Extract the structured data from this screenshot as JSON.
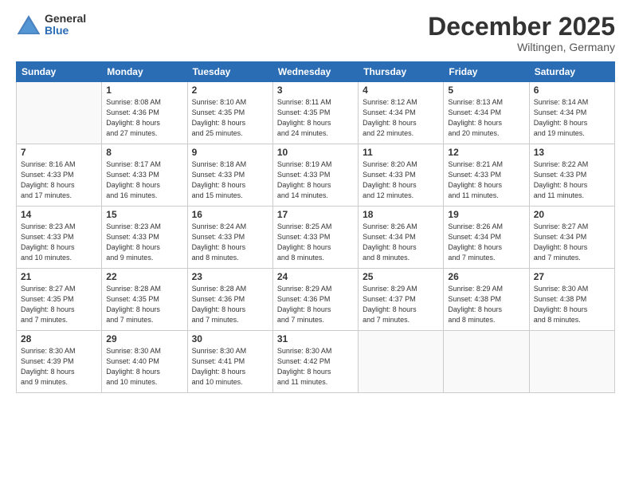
{
  "header": {
    "logo_general": "General",
    "logo_blue": "Blue",
    "month_title": "December 2025",
    "location": "Wiltingen, Germany"
  },
  "days_of_week": [
    "Sunday",
    "Monday",
    "Tuesday",
    "Wednesday",
    "Thursday",
    "Friday",
    "Saturday"
  ],
  "weeks": [
    [
      {
        "day": "",
        "info": ""
      },
      {
        "day": "1",
        "info": "Sunrise: 8:08 AM\nSunset: 4:36 PM\nDaylight: 8 hours\nand 27 minutes."
      },
      {
        "day": "2",
        "info": "Sunrise: 8:10 AM\nSunset: 4:35 PM\nDaylight: 8 hours\nand 25 minutes."
      },
      {
        "day": "3",
        "info": "Sunrise: 8:11 AM\nSunset: 4:35 PM\nDaylight: 8 hours\nand 24 minutes."
      },
      {
        "day": "4",
        "info": "Sunrise: 8:12 AM\nSunset: 4:34 PM\nDaylight: 8 hours\nand 22 minutes."
      },
      {
        "day": "5",
        "info": "Sunrise: 8:13 AM\nSunset: 4:34 PM\nDaylight: 8 hours\nand 20 minutes."
      },
      {
        "day": "6",
        "info": "Sunrise: 8:14 AM\nSunset: 4:34 PM\nDaylight: 8 hours\nand 19 minutes."
      }
    ],
    [
      {
        "day": "7",
        "info": "Sunrise: 8:16 AM\nSunset: 4:33 PM\nDaylight: 8 hours\nand 17 minutes."
      },
      {
        "day": "8",
        "info": "Sunrise: 8:17 AM\nSunset: 4:33 PM\nDaylight: 8 hours\nand 16 minutes."
      },
      {
        "day": "9",
        "info": "Sunrise: 8:18 AM\nSunset: 4:33 PM\nDaylight: 8 hours\nand 15 minutes."
      },
      {
        "day": "10",
        "info": "Sunrise: 8:19 AM\nSunset: 4:33 PM\nDaylight: 8 hours\nand 14 minutes."
      },
      {
        "day": "11",
        "info": "Sunrise: 8:20 AM\nSunset: 4:33 PM\nDaylight: 8 hours\nand 12 minutes."
      },
      {
        "day": "12",
        "info": "Sunrise: 8:21 AM\nSunset: 4:33 PM\nDaylight: 8 hours\nand 11 minutes."
      },
      {
        "day": "13",
        "info": "Sunrise: 8:22 AM\nSunset: 4:33 PM\nDaylight: 8 hours\nand 11 minutes."
      }
    ],
    [
      {
        "day": "14",
        "info": "Sunrise: 8:23 AM\nSunset: 4:33 PM\nDaylight: 8 hours\nand 10 minutes."
      },
      {
        "day": "15",
        "info": "Sunrise: 8:23 AM\nSunset: 4:33 PM\nDaylight: 8 hours\nand 9 minutes."
      },
      {
        "day": "16",
        "info": "Sunrise: 8:24 AM\nSunset: 4:33 PM\nDaylight: 8 hours\nand 8 minutes."
      },
      {
        "day": "17",
        "info": "Sunrise: 8:25 AM\nSunset: 4:33 PM\nDaylight: 8 hours\nand 8 minutes."
      },
      {
        "day": "18",
        "info": "Sunrise: 8:26 AM\nSunset: 4:34 PM\nDaylight: 8 hours\nand 8 minutes."
      },
      {
        "day": "19",
        "info": "Sunrise: 8:26 AM\nSunset: 4:34 PM\nDaylight: 8 hours\nand 7 minutes."
      },
      {
        "day": "20",
        "info": "Sunrise: 8:27 AM\nSunset: 4:34 PM\nDaylight: 8 hours\nand 7 minutes."
      }
    ],
    [
      {
        "day": "21",
        "info": "Sunrise: 8:27 AM\nSunset: 4:35 PM\nDaylight: 8 hours\nand 7 minutes."
      },
      {
        "day": "22",
        "info": "Sunrise: 8:28 AM\nSunset: 4:35 PM\nDaylight: 8 hours\nand 7 minutes."
      },
      {
        "day": "23",
        "info": "Sunrise: 8:28 AM\nSunset: 4:36 PM\nDaylight: 8 hours\nand 7 minutes."
      },
      {
        "day": "24",
        "info": "Sunrise: 8:29 AM\nSunset: 4:36 PM\nDaylight: 8 hours\nand 7 minutes."
      },
      {
        "day": "25",
        "info": "Sunrise: 8:29 AM\nSunset: 4:37 PM\nDaylight: 8 hours\nand 7 minutes."
      },
      {
        "day": "26",
        "info": "Sunrise: 8:29 AM\nSunset: 4:38 PM\nDaylight: 8 hours\nand 8 minutes."
      },
      {
        "day": "27",
        "info": "Sunrise: 8:30 AM\nSunset: 4:38 PM\nDaylight: 8 hours\nand 8 minutes."
      }
    ],
    [
      {
        "day": "28",
        "info": "Sunrise: 8:30 AM\nSunset: 4:39 PM\nDaylight: 8 hours\nand 9 minutes."
      },
      {
        "day": "29",
        "info": "Sunrise: 8:30 AM\nSunset: 4:40 PM\nDaylight: 8 hours\nand 10 minutes."
      },
      {
        "day": "30",
        "info": "Sunrise: 8:30 AM\nSunset: 4:41 PM\nDaylight: 8 hours\nand 10 minutes."
      },
      {
        "day": "31",
        "info": "Sunrise: 8:30 AM\nSunset: 4:42 PM\nDaylight: 8 hours\nand 11 minutes."
      },
      {
        "day": "",
        "info": ""
      },
      {
        "day": "",
        "info": ""
      },
      {
        "day": "",
        "info": ""
      }
    ]
  ]
}
